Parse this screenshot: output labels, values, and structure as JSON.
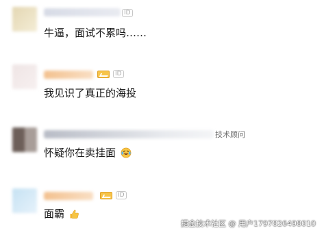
{
  "comments": [
    {
      "avatar_colors": [
        "#e9dfbf",
        "#f3ecd2"
      ],
      "username_visible": false,
      "badges": [
        "id-badge"
      ],
      "text": "牛逼，面试不累吗……"
    },
    {
      "avatar_colors": [
        "#efe4e4",
        "#f6eeee"
      ],
      "username_visible": false,
      "badges": [
        "vip-badge",
        "id-badge"
      ],
      "text": "我见识了真正的海投"
    },
    {
      "avatar_colors": [
        "#7d6e66",
        "#b0a59f"
      ],
      "username_visible": false,
      "badges": [],
      "role": "技术顾问",
      "text": "怀疑你在卖挂面",
      "emoji": "laughing-tears-emoji"
    },
    {
      "avatar_colors": [
        "#cde5f4",
        "#e3f1fb"
      ],
      "username_visible": false,
      "badges": [
        "vip-badge",
        "id-badge"
      ],
      "text": "面霸",
      "emoji": "thumbs-up-emoji"
    }
  ],
  "id_badge_label": "ID",
  "watermark": "掘金技术社区 @ 用户1797826498010"
}
